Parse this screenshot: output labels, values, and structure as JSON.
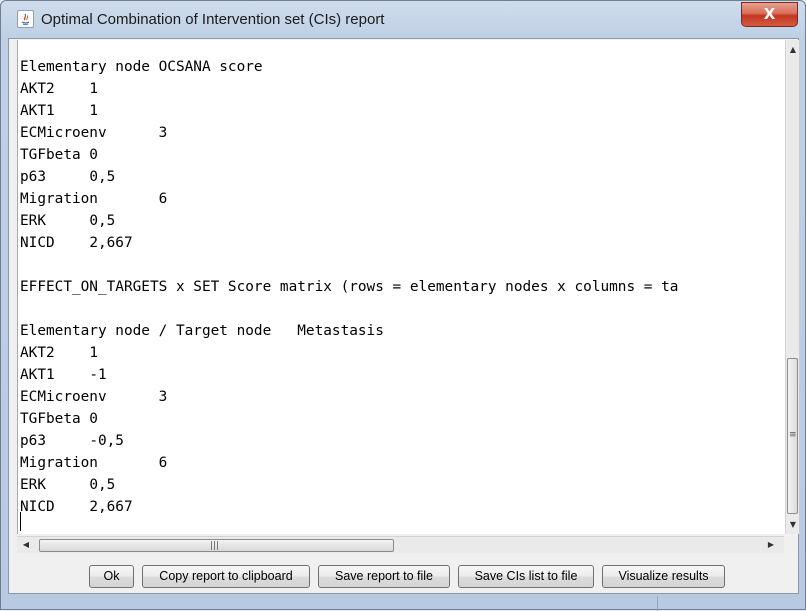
{
  "window": {
    "title": "Optimal Combination of Intervention set (CIs) report",
    "close_label": "X"
  },
  "report": {
    "lines": [
      "Elementary node OCSANA score",
      "AKT2\t1",
      "AKT1\t1",
      "ECMicroenv\t3",
      "TGFbeta 0",
      "p63\t0,5",
      "Migration\t6",
      "ERK\t0,5",
      "NICD\t2,667",
      "",
      "EFFECT_ON_TARGETS x SET Score matrix (rows = elementary nodes x columns = ta",
      "",
      "Elementary node / Target node\tMetastasis",
      "AKT2\t1",
      "AKT1\t-1",
      "ECMicroenv\t3",
      "TGFbeta 0",
      "p63\t-0,5",
      "Migration\t6",
      "ERK\t0,5",
      "NICD\t2,667"
    ]
  },
  "scroll": {
    "up_arrow": "▲",
    "down_arrow": "▼",
    "left_arrow": "◀",
    "right_arrow": "▶",
    "grip_v": "≡",
    "grip_h": "|||"
  },
  "buttons": {
    "ok": "Ok",
    "copy": "Copy report to clipboard",
    "save_report": "Save report to file",
    "save_cis": "Save CIs list to file",
    "visualize": "Visualize results"
  }
}
